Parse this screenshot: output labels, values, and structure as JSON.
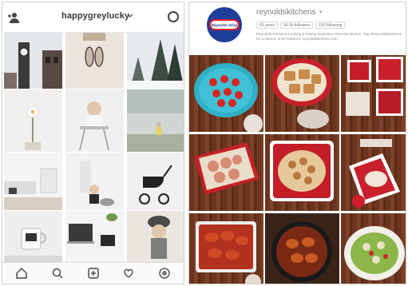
{
  "left_phone": {
    "username": "happygreylucky",
    "icons": [
      "add-person-icon",
      "chevron-down-icon",
      "history-icon"
    ],
    "grid_posts": [
      "clock-tower-photo",
      "sandals-photo",
      "snowy-trees-photo",
      "flower-photo",
      "baby-highchair-photo",
      "child-on-path-photo",
      "living-room-photo",
      "baby-with-dog-photo",
      "stroller-photo",
      "coffee-mug-photo",
      "laptop-desk-photo",
      "child-hat-photo"
    ],
    "nav_icons": [
      "home-icon",
      "search-icon",
      "add-icon",
      "heart-icon",
      "profile-icon"
    ]
  },
  "right_tablet": {
    "logo_text": "Reynolds Wrap",
    "username": "reynoldskitchens",
    "stats": [
      "65 posts",
      "34.5k followers",
      "183 following"
    ],
    "bio": "Reynolds Kitchens Cooking & baking inspiration from the kitchen. Tag #ReynoldsKitchens for a chance to be featured. reynoldskitchens.com",
    "grid_posts": [
      "strawberries-plate-photo",
      "cookie-bars-photo",
      "strawberry-baskets-photo",
      "sheet-pan-dish-photo",
      "baked-casserole-photo",
      "strawberry-tart-photo",
      "chicken-wings-photo",
      "roasted-chicken-skillet-photo",
      "salad-platter-photo"
    ]
  }
}
